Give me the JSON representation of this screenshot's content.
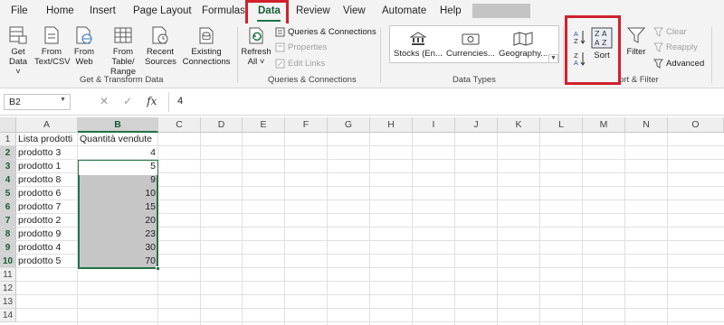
{
  "tabs": [
    "File",
    "Home",
    "Insert",
    "Page Layout",
    "Formulas",
    "Data",
    "Review",
    "View",
    "Automate",
    "Help"
  ],
  "active_tab": "Data",
  "ribbon": {
    "get_transform": {
      "get_data": [
        "Get",
        "Data ˅"
      ],
      "from_text": [
        "From",
        "Text/CSV"
      ],
      "from_web": [
        "From",
        "Web"
      ],
      "from_table": [
        "From Table/",
        "Range"
      ],
      "recent_sources": [
        "Recent",
        "Sources"
      ],
      "existing_connections": [
        "Existing",
        "Connections"
      ],
      "label": "Get & Transform Data"
    },
    "queries": {
      "refresh": [
        "Refresh",
        "All ˅"
      ],
      "queries_connections": "Queries & Connections",
      "properties": "Properties",
      "edit_links": "Edit Links",
      "label": "Queries & Connections"
    },
    "data_types": {
      "stocks": "Stocks (En...",
      "currencies": "Currencies...",
      "geography": "Geography...",
      "label": "Data Types"
    },
    "sort_filter": {
      "sort": "Sort",
      "filter": "Filter",
      "clear": "Clear",
      "reapply": "Reapply",
      "advanced": "Advanced",
      "label": "ort & Filter"
    }
  },
  "formula_bar": {
    "name_box": "B2",
    "cancel_icon": "✕",
    "enter_icon": "✓",
    "fx": "fx",
    "value": "4"
  },
  "columns": [
    "A",
    "B",
    "C",
    "D",
    "E",
    "F",
    "G",
    "H",
    "I",
    "J",
    "K",
    "L",
    "M",
    "N",
    "O"
  ],
  "rows": [
    "1",
    "2",
    "3",
    "4",
    "5",
    "6",
    "7",
    "8",
    "9",
    "10",
    "11",
    "12",
    "13",
    "14"
  ],
  "sheet": {
    "header_a": "Lista prodotti",
    "header_b": "Quantità vendute",
    "data": [
      {
        "product": "prodotto 3",
        "qty": "4"
      },
      {
        "product": "prodotto 1",
        "qty": "5"
      },
      {
        "product": "prodotto 8",
        "qty": "9"
      },
      {
        "product": "prodotto 6",
        "qty": "10"
      },
      {
        "product": "prodotto 7",
        "qty": "15"
      },
      {
        "product": "prodotto 2",
        "qty": "20"
      },
      {
        "product": "prodotto 9",
        "qty": "23"
      },
      {
        "product": "prodotto 4",
        "qty": "30"
      },
      {
        "product": "prodotto 5",
        "qty": "70"
      }
    ]
  },
  "colors": {
    "excel_green": "#217346",
    "highlight_red": "#d0212d",
    "selection_fill": "#c6c6c6"
  }
}
